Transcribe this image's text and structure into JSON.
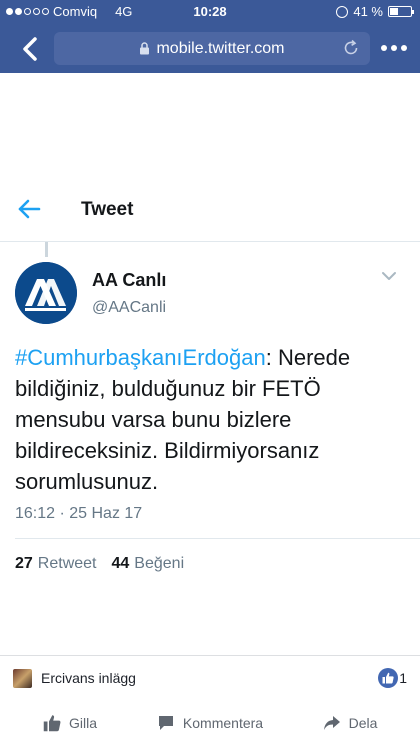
{
  "status_bar": {
    "carrier": "Comviq",
    "network": "4G",
    "time": "10:28",
    "battery": "41 %",
    "battery_level": 0.41
  },
  "browser": {
    "url": "mobile.twitter.com"
  },
  "header": {
    "title": "Tweet"
  },
  "tweet": {
    "author_name": "AA Canlı",
    "author_handle": "@AACanli",
    "hashtag": "#CumhurbaşkanıErdoğan",
    "text": ": Nerede bildiğiniz, bulduğunuz bir FETÖ mensubu varsa bunu bizlere bildireceksiniz. Bildirmiyorsanız sorumlusunuz.",
    "timestamp": "16:12 · 25 Haz 17",
    "retweets_count": "27",
    "retweets_label": "Retweet",
    "likes_count": "44",
    "likes_label": "Beğeni"
  },
  "facebook": {
    "post_author": "Ercivans inlägg",
    "reactions_count": "1",
    "actions": {
      "like": "Gilla",
      "comment": "Kommentera",
      "share": "Dela"
    }
  },
  "colors": {
    "facebook_blue": "#3b5998",
    "twitter_blue": "#1da1f2",
    "aa_blue": "#0c4a8c"
  }
}
